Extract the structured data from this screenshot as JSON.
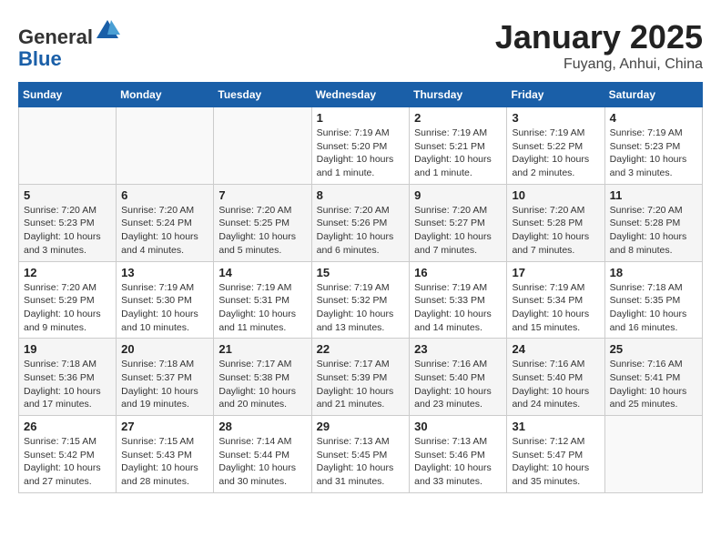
{
  "header": {
    "logo_line1": "General",
    "logo_line2": "Blue",
    "month": "January 2025",
    "location": "Fuyang, Anhui, China"
  },
  "weekdays": [
    "Sunday",
    "Monday",
    "Tuesday",
    "Wednesday",
    "Thursday",
    "Friday",
    "Saturday"
  ],
  "weeks": [
    [
      {
        "day": "",
        "info": ""
      },
      {
        "day": "",
        "info": ""
      },
      {
        "day": "",
        "info": ""
      },
      {
        "day": "1",
        "info": "Sunrise: 7:19 AM\nSunset: 5:20 PM\nDaylight: 10 hours\nand 1 minute."
      },
      {
        "day": "2",
        "info": "Sunrise: 7:19 AM\nSunset: 5:21 PM\nDaylight: 10 hours\nand 1 minute."
      },
      {
        "day": "3",
        "info": "Sunrise: 7:19 AM\nSunset: 5:22 PM\nDaylight: 10 hours\nand 2 minutes."
      },
      {
        "day": "4",
        "info": "Sunrise: 7:19 AM\nSunset: 5:23 PM\nDaylight: 10 hours\nand 3 minutes."
      }
    ],
    [
      {
        "day": "5",
        "info": "Sunrise: 7:20 AM\nSunset: 5:23 PM\nDaylight: 10 hours\nand 3 minutes."
      },
      {
        "day": "6",
        "info": "Sunrise: 7:20 AM\nSunset: 5:24 PM\nDaylight: 10 hours\nand 4 minutes."
      },
      {
        "day": "7",
        "info": "Sunrise: 7:20 AM\nSunset: 5:25 PM\nDaylight: 10 hours\nand 5 minutes."
      },
      {
        "day": "8",
        "info": "Sunrise: 7:20 AM\nSunset: 5:26 PM\nDaylight: 10 hours\nand 6 minutes."
      },
      {
        "day": "9",
        "info": "Sunrise: 7:20 AM\nSunset: 5:27 PM\nDaylight: 10 hours\nand 7 minutes."
      },
      {
        "day": "10",
        "info": "Sunrise: 7:20 AM\nSunset: 5:28 PM\nDaylight: 10 hours\nand 7 minutes."
      },
      {
        "day": "11",
        "info": "Sunrise: 7:20 AM\nSunset: 5:28 PM\nDaylight: 10 hours\nand 8 minutes."
      }
    ],
    [
      {
        "day": "12",
        "info": "Sunrise: 7:20 AM\nSunset: 5:29 PM\nDaylight: 10 hours\nand 9 minutes."
      },
      {
        "day": "13",
        "info": "Sunrise: 7:19 AM\nSunset: 5:30 PM\nDaylight: 10 hours\nand 10 minutes."
      },
      {
        "day": "14",
        "info": "Sunrise: 7:19 AM\nSunset: 5:31 PM\nDaylight: 10 hours\nand 11 minutes."
      },
      {
        "day": "15",
        "info": "Sunrise: 7:19 AM\nSunset: 5:32 PM\nDaylight: 10 hours\nand 13 minutes."
      },
      {
        "day": "16",
        "info": "Sunrise: 7:19 AM\nSunset: 5:33 PM\nDaylight: 10 hours\nand 14 minutes."
      },
      {
        "day": "17",
        "info": "Sunrise: 7:19 AM\nSunset: 5:34 PM\nDaylight: 10 hours\nand 15 minutes."
      },
      {
        "day": "18",
        "info": "Sunrise: 7:18 AM\nSunset: 5:35 PM\nDaylight: 10 hours\nand 16 minutes."
      }
    ],
    [
      {
        "day": "19",
        "info": "Sunrise: 7:18 AM\nSunset: 5:36 PM\nDaylight: 10 hours\nand 17 minutes."
      },
      {
        "day": "20",
        "info": "Sunrise: 7:18 AM\nSunset: 5:37 PM\nDaylight: 10 hours\nand 19 minutes."
      },
      {
        "day": "21",
        "info": "Sunrise: 7:17 AM\nSunset: 5:38 PM\nDaylight: 10 hours\nand 20 minutes."
      },
      {
        "day": "22",
        "info": "Sunrise: 7:17 AM\nSunset: 5:39 PM\nDaylight: 10 hours\nand 21 minutes."
      },
      {
        "day": "23",
        "info": "Sunrise: 7:16 AM\nSunset: 5:40 PM\nDaylight: 10 hours\nand 23 minutes."
      },
      {
        "day": "24",
        "info": "Sunrise: 7:16 AM\nSunset: 5:40 PM\nDaylight: 10 hours\nand 24 minutes."
      },
      {
        "day": "25",
        "info": "Sunrise: 7:16 AM\nSunset: 5:41 PM\nDaylight: 10 hours\nand 25 minutes."
      }
    ],
    [
      {
        "day": "26",
        "info": "Sunrise: 7:15 AM\nSunset: 5:42 PM\nDaylight: 10 hours\nand 27 minutes."
      },
      {
        "day": "27",
        "info": "Sunrise: 7:15 AM\nSunset: 5:43 PM\nDaylight: 10 hours\nand 28 minutes."
      },
      {
        "day": "28",
        "info": "Sunrise: 7:14 AM\nSunset: 5:44 PM\nDaylight: 10 hours\nand 30 minutes."
      },
      {
        "day": "29",
        "info": "Sunrise: 7:13 AM\nSunset: 5:45 PM\nDaylight: 10 hours\nand 31 minutes."
      },
      {
        "day": "30",
        "info": "Sunrise: 7:13 AM\nSunset: 5:46 PM\nDaylight: 10 hours\nand 33 minutes."
      },
      {
        "day": "31",
        "info": "Sunrise: 7:12 AM\nSunset: 5:47 PM\nDaylight: 10 hours\nand 35 minutes."
      },
      {
        "day": "",
        "info": ""
      }
    ]
  ]
}
